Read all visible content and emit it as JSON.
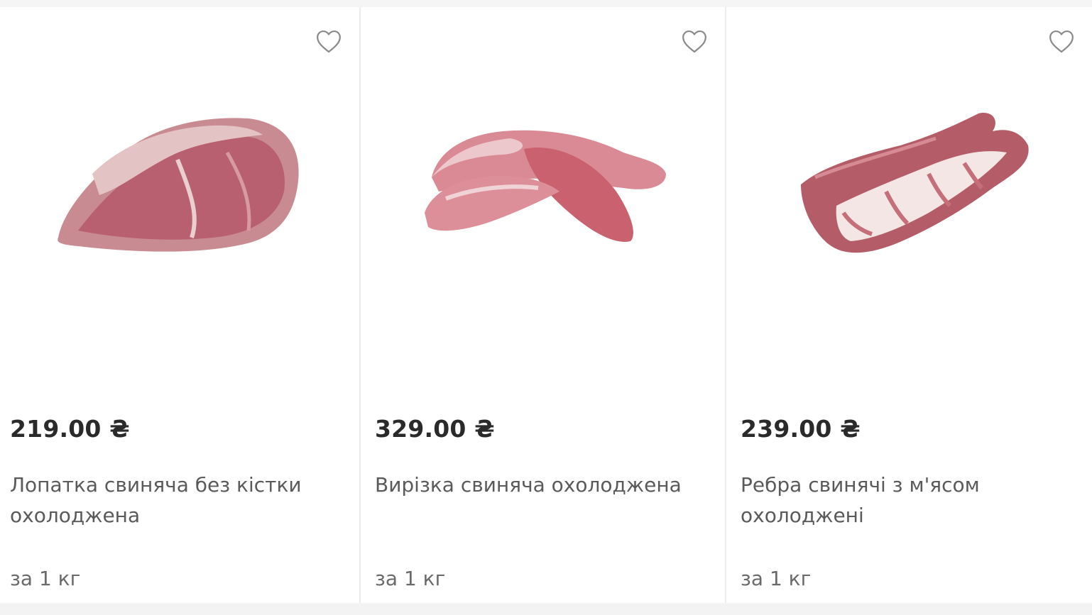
{
  "products": [
    {
      "price": "219.00 ₴",
      "name": "Лопатка свиняча без кістки охолоджена",
      "unit": "за 1 кг",
      "image_alt": "pork-shoulder",
      "favorite_icon": "heart-outline-icon"
    },
    {
      "price": "329.00 ₴",
      "name": "Вирізка свиняча охолоджена",
      "unit": "за 1 кг",
      "image_alt": "pork-tenderloin",
      "favorite_icon": "heart-outline-icon"
    },
    {
      "price": "239.00 ₴",
      "name": "Ребра свинячі з м'ясом охолоджені",
      "unit": "за 1 кг",
      "image_alt": "pork-ribs",
      "favorite_icon": "heart-outline-icon"
    }
  ],
  "colors": {
    "price_text": "#2a2a2a",
    "name_text": "#5a5a5a",
    "unit_text": "#6a6a6a",
    "icon": "#8a8a8a",
    "card_bg": "#ffffff",
    "divider": "#ececec"
  }
}
